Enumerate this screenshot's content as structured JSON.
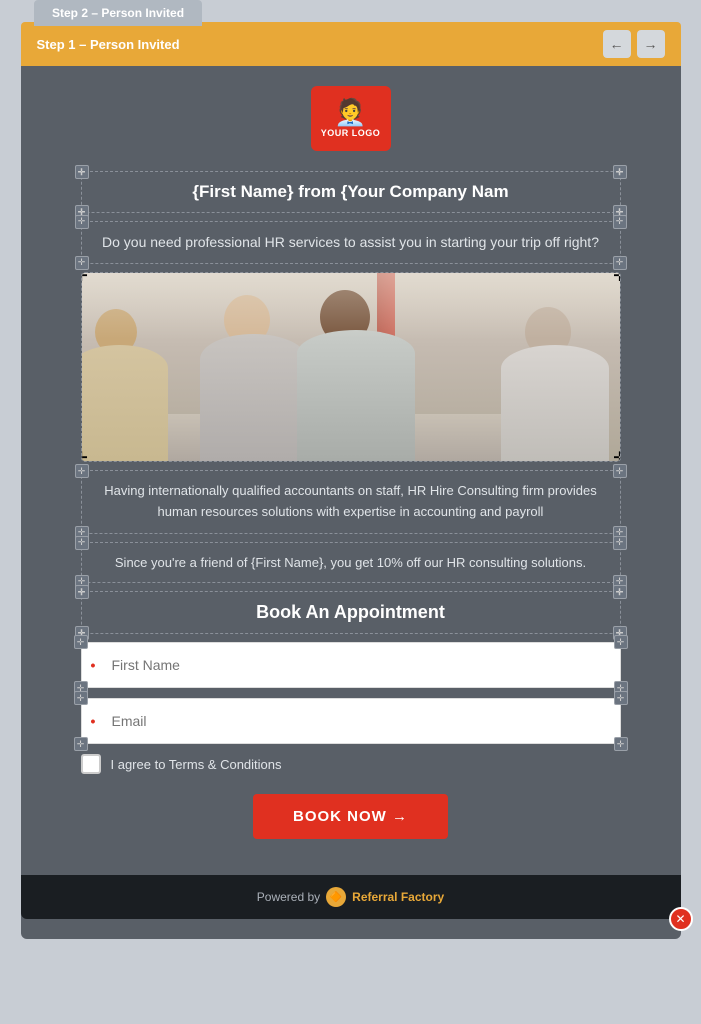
{
  "tabs": {
    "tab1": "Step 1 – Person Invited",
    "tab2": "Step 2 – Person Invited"
  },
  "nav": {
    "back_arrow": "←",
    "forward_arrow": "→"
  },
  "logo": {
    "text": "YOUR LOGO",
    "icon": "👤"
  },
  "title_block": {
    "text": "{First Name} from {Your Company Nam"
  },
  "subtitle_block": {
    "text": "Do you need professional HR services to assist you in starting your trip off right?"
  },
  "description_block": {
    "text": "Having internationally qualified accountants on staff, HR Hire Consulting firm provides human resources solutions with expertise in accounting and payroll"
  },
  "promo_block": {
    "text": "Since you're a friend of {First Name}, you get 10% off our HR consulting solutions."
  },
  "appointment": {
    "header": "Book An Appointment"
  },
  "form": {
    "first_name_placeholder": "First Name",
    "email_placeholder": "Email",
    "required_indicator": "•",
    "terms_label": "I agree to Terms & Conditions",
    "submit_button": "BOOK NOW →"
  },
  "footer": {
    "powered_by": "Powered by",
    "brand_name": "Referral Factory"
  },
  "corner_icons": {
    "symbol": "✛"
  }
}
